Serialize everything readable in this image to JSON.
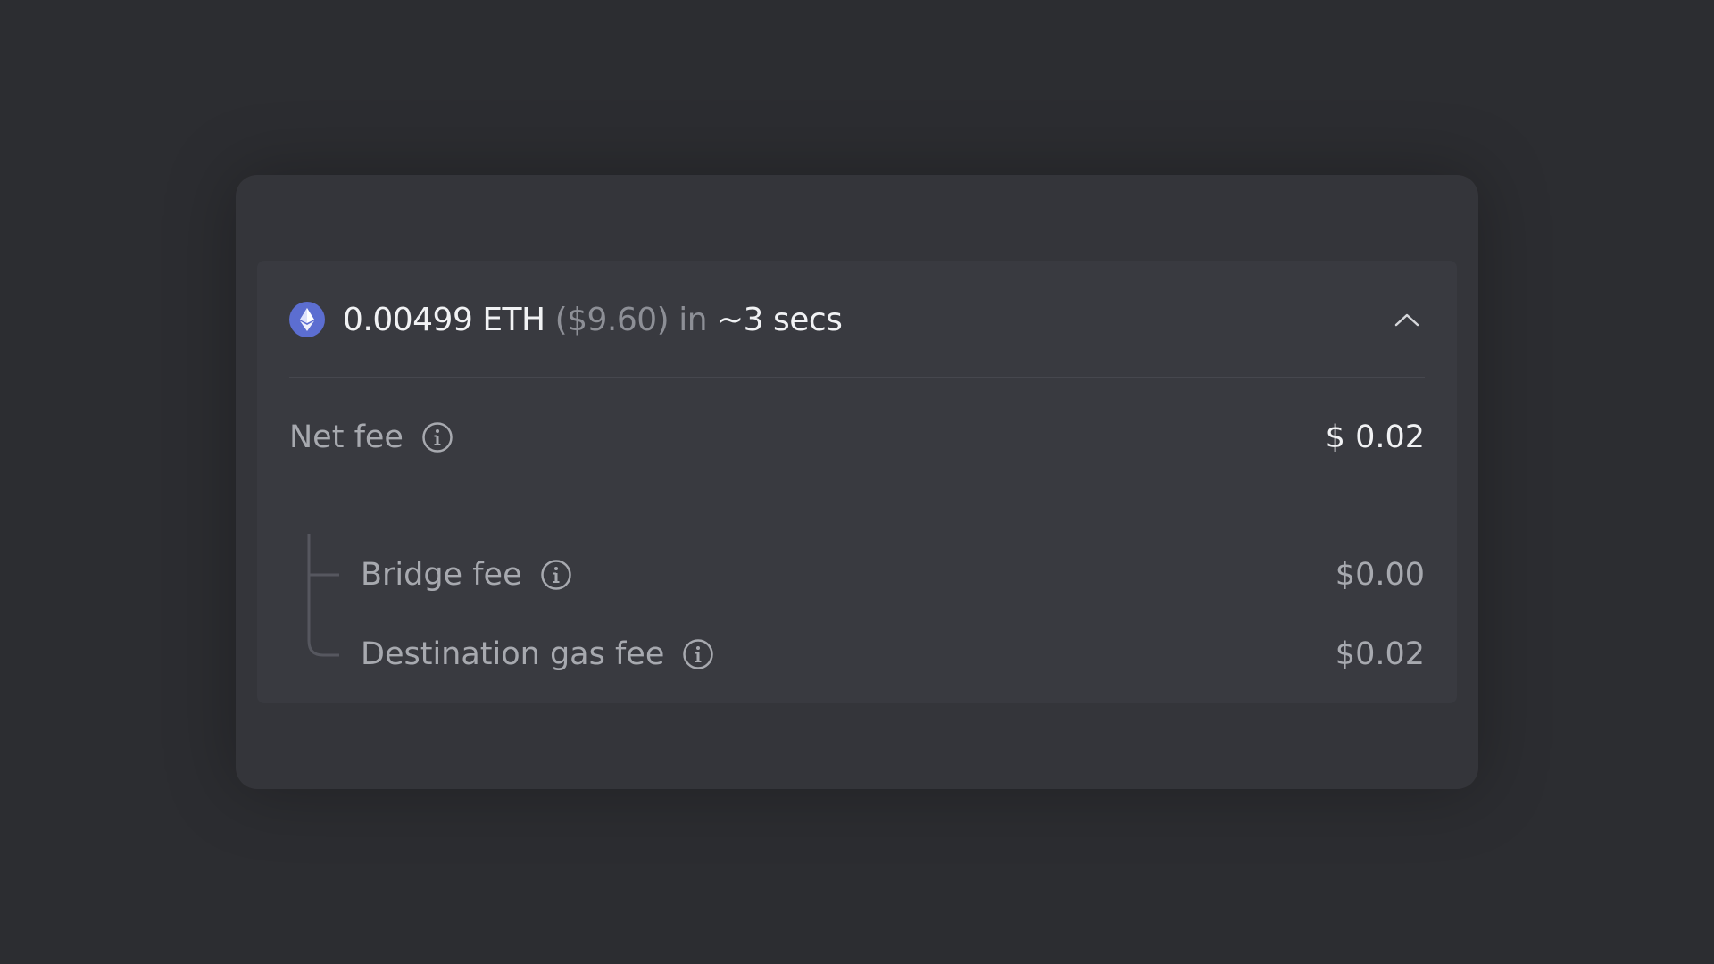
{
  "summary": {
    "amount": "0.00499 ETH",
    "usd": "($9.60)",
    "in_word": "in",
    "time": "~3 secs"
  },
  "net_fee": {
    "label": "Net fee",
    "value": "$ 0.02"
  },
  "breakdown": [
    {
      "label": "Bridge fee",
      "value": "$0.00"
    },
    {
      "label": "Destination gas fee",
      "value": "$0.02"
    }
  ],
  "icons": {
    "token": "ethereum-icon",
    "collapse": "chevron-up-icon",
    "info": "info-icon"
  },
  "colors": {
    "background": "#2c2d31",
    "card": "#34353a",
    "panel": "#393a40",
    "eth_accent": "#5c6ed1",
    "text_primary": "#f1f2f4",
    "text_secondary": "#a7a9af"
  }
}
